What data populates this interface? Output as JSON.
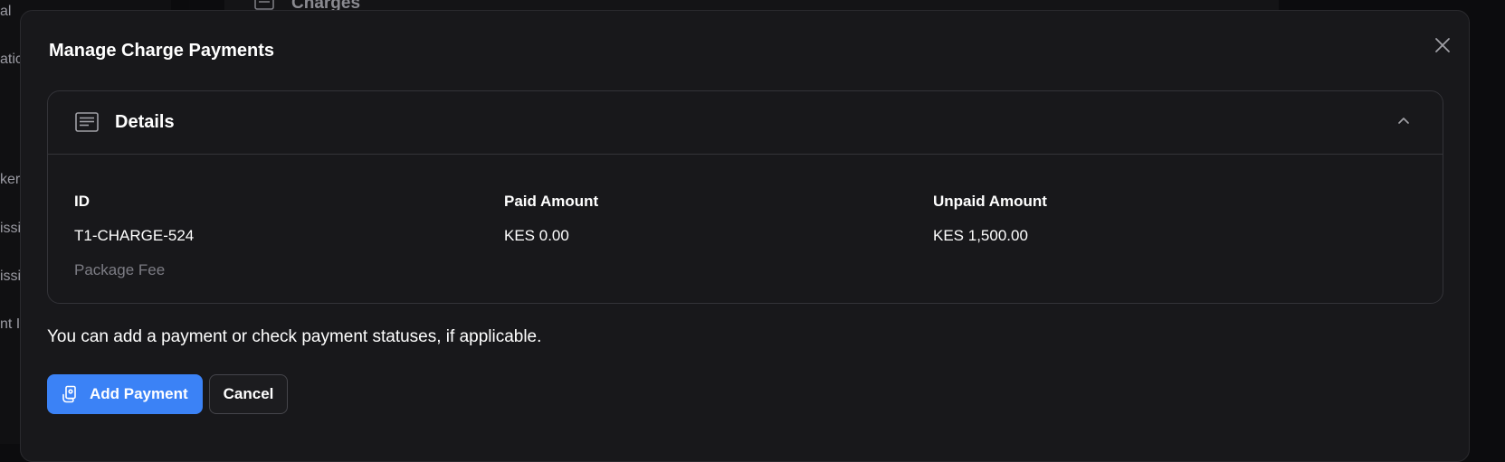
{
  "background": {
    "sidebar_fragments": [
      "al",
      "atic",
      "kers",
      "issi",
      "issi",
      "nt I"
    ],
    "page_heading": "Charges"
  },
  "modal": {
    "title": "Manage Charge Payments",
    "details": {
      "title": "Details",
      "columns": [
        {
          "label": "ID",
          "value": "T1-CHARGE-524",
          "sub": "Package Fee"
        },
        {
          "label": "Paid Amount",
          "value": "KES 0.00"
        },
        {
          "label": "Unpaid Amount",
          "value": "KES 1,500.00"
        }
      ]
    },
    "helper_text": "You can add a payment or check payment statuses, if applicable.",
    "buttons": {
      "add_payment": "Add Payment",
      "cancel": "Cancel"
    }
  },
  "colors": {
    "modal_bg": "#18181b",
    "primary_button": "#3b82f6",
    "muted_text": "#7c7c84"
  },
  "icons": {
    "close": "close-icon",
    "details": "document-lines-icon",
    "collapse": "chevron-up-icon",
    "add_payment": "payment-hand-icon"
  }
}
